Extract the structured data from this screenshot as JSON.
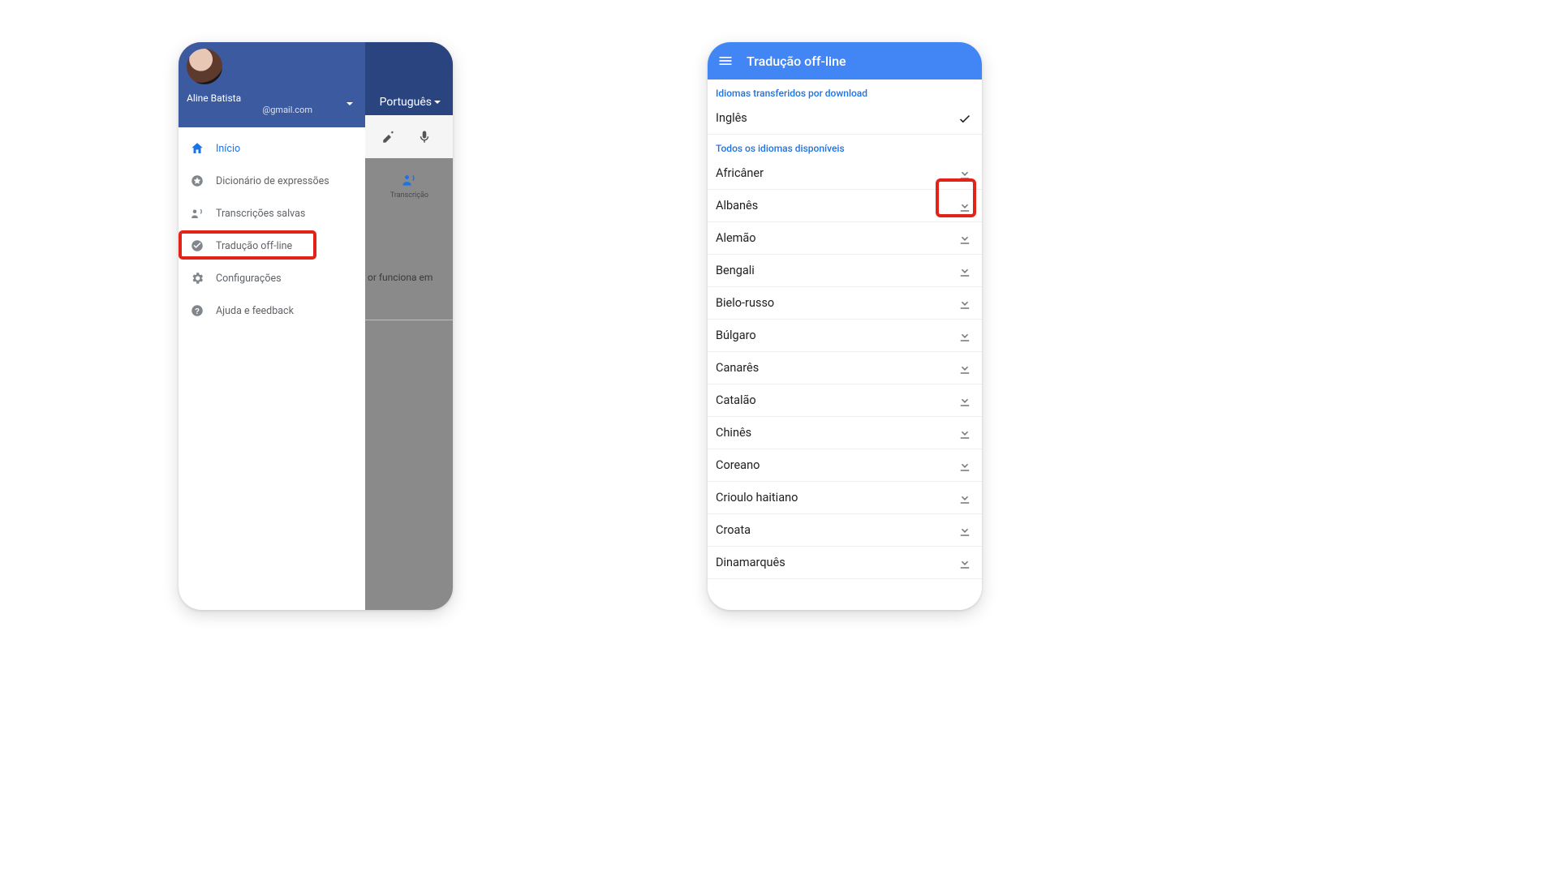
{
  "colors": {
    "accent": "#4285f4",
    "link": "#1a73e8",
    "highlight": "#e2231a"
  },
  "left": {
    "user": {
      "name": "Aline Batista",
      "email": "@gmail.com"
    },
    "bg": {
      "language_label": "Português",
      "transcription_label": "Transcrição",
      "hint_fragment": "or funciona em"
    },
    "menu": [
      {
        "icon": "home",
        "label": "Início",
        "active": true
      },
      {
        "icon": "star",
        "label": "Dicionário de expressões",
        "active": false
      },
      {
        "icon": "record",
        "label": "Transcrições salvas",
        "active": false
      },
      {
        "icon": "offline",
        "label": "Tradução off-line",
        "active": false,
        "highlight": true
      },
      {
        "icon": "settings",
        "label": "Configurações",
        "active": false
      },
      {
        "icon": "help",
        "label": "Ajuda e feedback",
        "active": false
      }
    ]
  },
  "right": {
    "title": "Tradução off-line",
    "section_downloaded": "Idiomas transferidos por download",
    "downloaded": [
      {
        "name": "Inglês",
        "status": "done"
      }
    ],
    "section_available": "Todos os idiomas disponíveis",
    "available": [
      {
        "name": "Africâner",
        "highlight": true
      },
      {
        "name": "Albanês"
      },
      {
        "name": "Alemão"
      },
      {
        "name": "Bengali"
      },
      {
        "name": "Bielo-russo"
      },
      {
        "name": "Búlgaro"
      },
      {
        "name": "Canarês"
      },
      {
        "name": "Catalão"
      },
      {
        "name": "Chinês"
      },
      {
        "name": "Coreano"
      },
      {
        "name": "Crioulo haitiano"
      },
      {
        "name": "Croata"
      },
      {
        "name": "Dinamarquês"
      }
    ]
  }
}
